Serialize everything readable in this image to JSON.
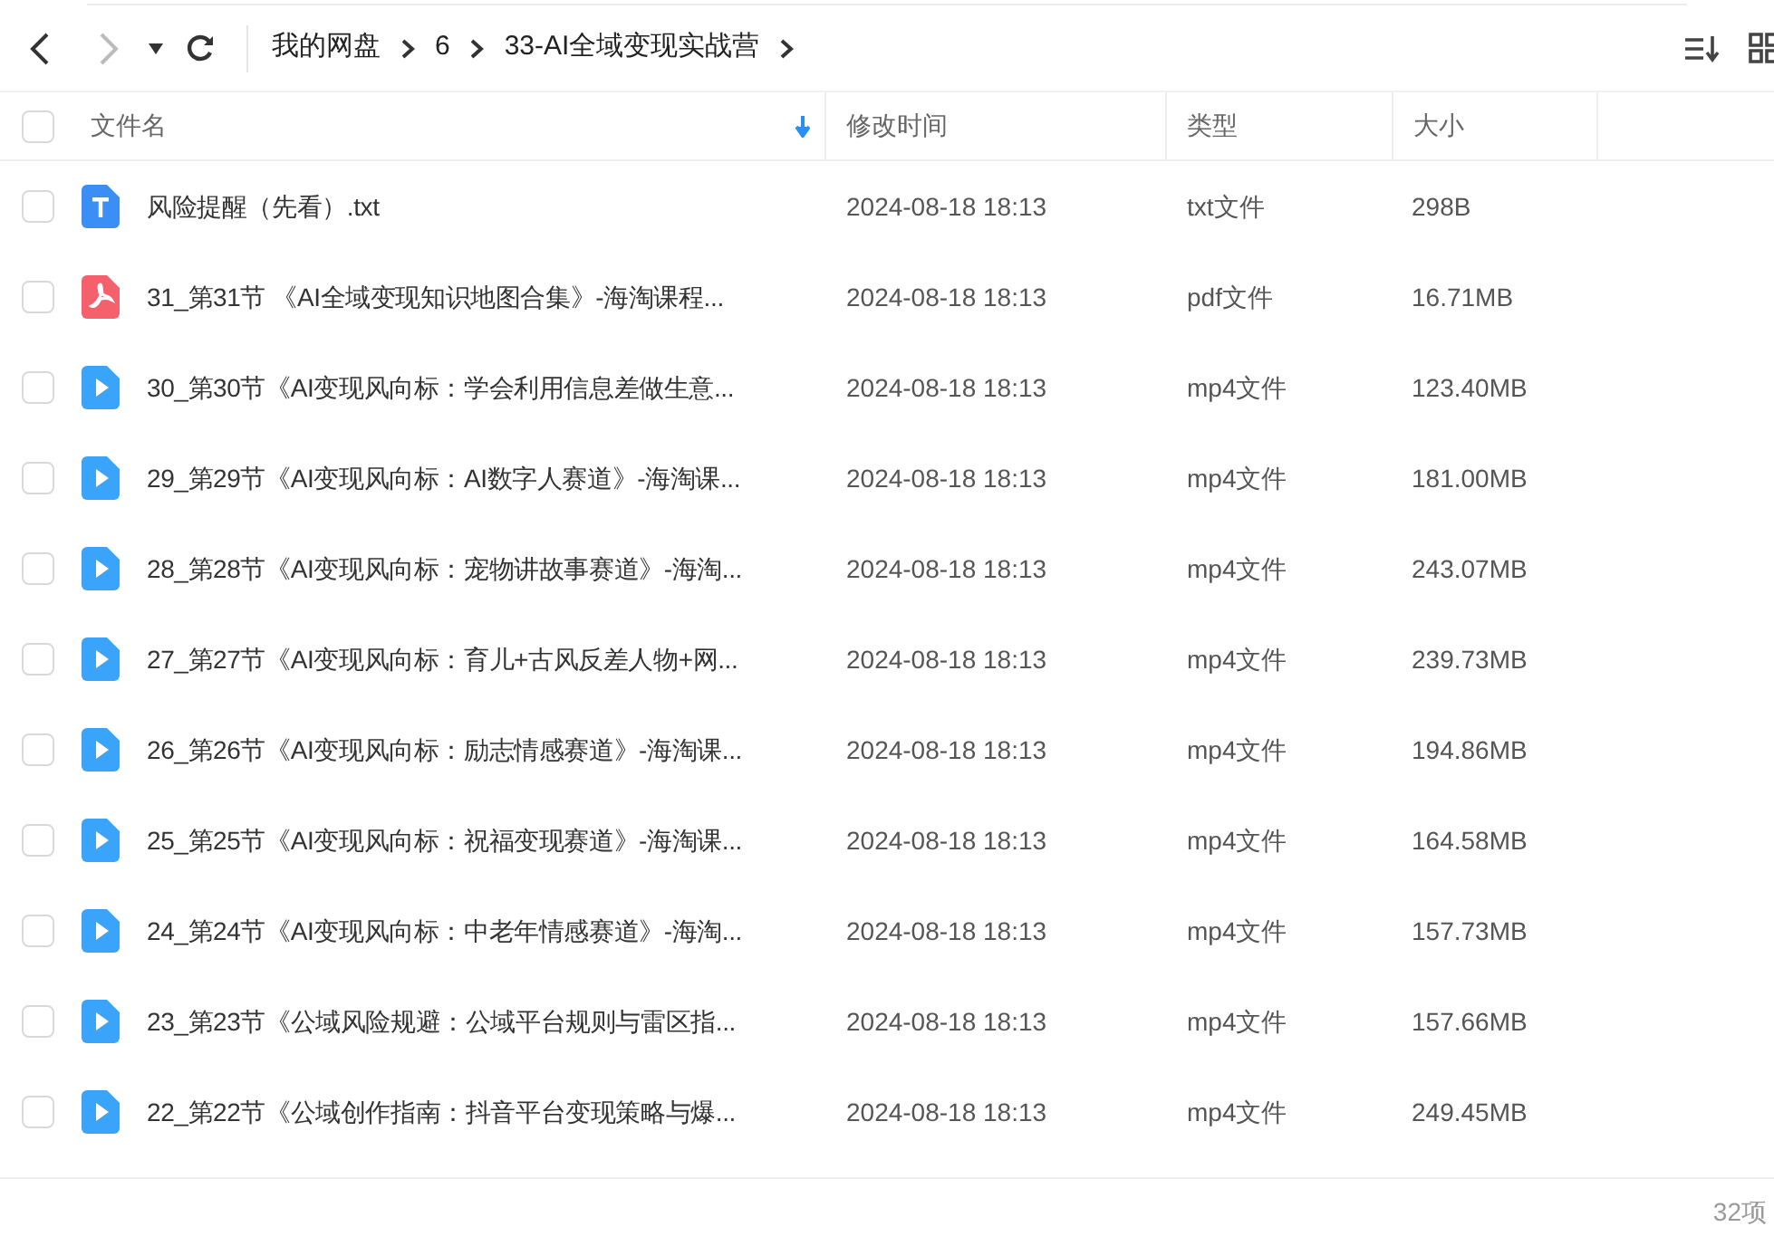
{
  "toolbar": {
    "breadcrumbs": [
      "我的网盘",
      "6",
      "33-AI全域变现实战营"
    ]
  },
  "columns": [
    {
      "label": "文件名",
      "sorted": true
    },
    {
      "label": "修改时间",
      "sorted": false
    },
    {
      "label": "类型",
      "sorted": false
    },
    {
      "label": "大小",
      "sorted": false
    }
  ],
  "select_all": {
    "checked": false
  },
  "rows": [
    {
      "kind": "text",
      "checked": false,
      "name": "风险提醒（先看）.txt",
      "modified": "2024-08-18 18:13",
      "type": "txt文件",
      "size": "298B"
    },
    {
      "kind": "pdf",
      "checked": false,
      "name": "31_第31节 《AI全域变现知识地图合集》-海淘课程...",
      "modified": "2024-08-18 18:13",
      "type": "pdf文件",
      "size": "16.71MB"
    },
    {
      "kind": "video",
      "checked": false,
      "name": "30_第30节《AI变现风向标：学会利用信息差做生意...",
      "modified": "2024-08-18 18:13",
      "type": "mp4文件",
      "size": "123.40MB"
    },
    {
      "kind": "video",
      "checked": false,
      "name": "29_第29节《AI变现风向标：AI数字人赛道》-海淘课...",
      "modified": "2024-08-18 18:13",
      "type": "mp4文件",
      "size": "181.00MB"
    },
    {
      "kind": "video",
      "checked": false,
      "name": "28_第28节《AI变现风向标：宠物讲故事赛道》-海淘...",
      "modified": "2024-08-18 18:13",
      "type": "mp4文件",
      "size": "243.07MB"
    },
    {
      "kind": "video",
      "checked": false,
      "name": "27_第27节《AI变现风向标：育儿+古风反差人物+网...",
      "modified": "2024-08-18 18:13",
      "type": "mp4文件",
      "size": "239.73MB"
    },
    {
      "kind": "video",
      "checked": false,
      "name": "26_第26节《AI变现风向标：励志情感赛道》-海淘课...",
      "modified": "2024-08-18 18:13",
      "type": "mp4文件",
      "size": "194.86MB"
    },
    {
      "kind": "video",
      "checked": false,
      "name": "25_第25节《AI变现风向标：祝福变现赛道》-海淘课...",
      "modified": "2024-08-18 18:13",
      "type": "mp4文件",
      "size": "164.58MB"
    },
    {
      "kind": "video",
      "checked": false,
      "name": "24_第24节《AI变现风向标：中老年情感赛道》-海淘...",
      "modified": "2024-08-18 18:13",
      "type": "mp4文件",
      "size": "157.73MB"
    },
    {
      "kind": "video",
      "checked": false,
      "name": "23_第23节《公域风险规避：公域平台规则与雷区指...",
      "modified": "2024-08-18 18:13",
      "type": "mp4文件",
      "size": "157.66MB"
    },
    {
      "kind": "video",
      "checked": false,
      "name": "22_第22节《公域创作指南：抖音平台变现策略与爆...",
      "modified": "2024-08-18 18:13",
      "type": "mp4文件",
      "size": "249.45MB"
    }
  ],
  "status_bar": {
    "count": "32项"
  }
}
